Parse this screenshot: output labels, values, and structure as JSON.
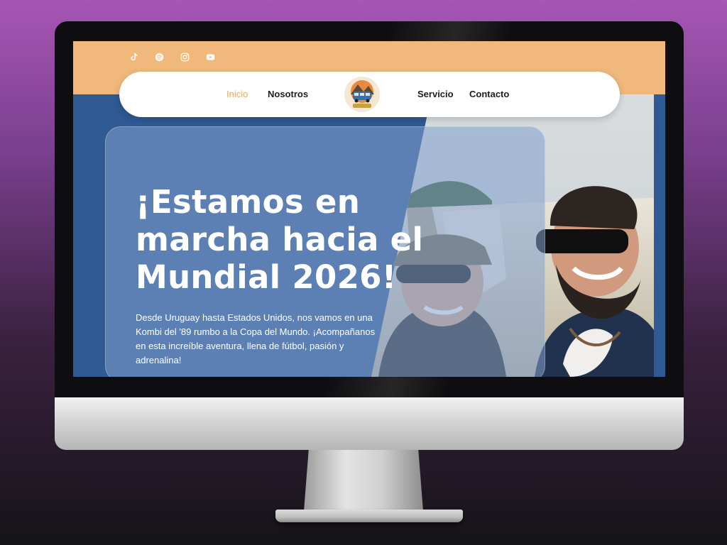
{
  "social": {
    "icons": [
      "tiktok-icon",
      "spotify-icon",
      "instagram-icon",
      "youtube-icon"
    ]
  },
  "nav": {
    "items": [
      {
        "label": "Inicio",
        "active": true
      },
      {
        "label": "Nosotros",
        "active": false
      },
      {
        "label": "Servicio",
        "active": false
      },
      {
        "label": "Contacto",
        "active": false
      }
    ]
  },
  "hero": {
    "title": "¡Estamos en marcha hacia el Mundial 2026!",
    "description": "Desde Uruguay hasta Estados Unidos, nos vamos en una Kombi del '89 rumbo a la Copa del Mundo. ¡Acompañanos en esta increíble aventura, llena de fútbol, pasión y adrenalina!"
  },
  "colors": {
    "topbar": "#f0b97b",
    "accent": "#f0a85c",
    "hero_blue": "#2f5a94"
  }
}
